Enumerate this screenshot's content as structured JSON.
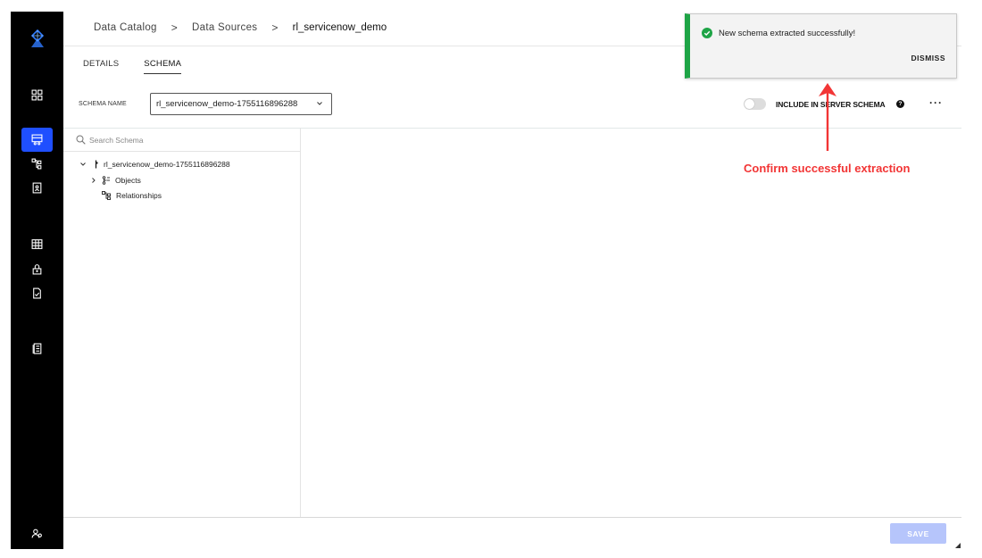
{
  "breadcrumb": {
    "item1": "Data Catalog",
    "item2": "Data Sources",
    "current": "rl_servicenow_demo",
    "separator": ">"
  },
  "tabs": {
    "details": "DETAILS",
    "schema": "SCHEMA"
  },
  "schema": {
    "name_label": "SCHEMA NAME",
    "selected": "rl_servicenow_demo-1755116896288",
    "include_label": "INCLUDE IN SERVER SCHEMA",
    "help": "?",
    "more": "···"
  },
  "search": {
    "placeholder": "Search Schema"
  },
  "tree": {
    "root": "rl_servicenow_demo-1755116896288",
    "objects": "Objects",
    "relationships": "Relationships"
  },
  "footer": {
    "save_label": "SAVE"
  },
  "toast": {
    "message": "New schema extracted successfully!",
    "dismiss_label": "DISMISS",
    "accent": "#1ea446"
  },
  "annotation": {
    "text": "Confirm successful extraction",
    "color": "#f23535"
  },
  "colors": {
    "nav_bg": "#000000",
    "nav_active": "#1f4fff",
    "save_disabled": "#b6c5fb"
  },
  "nav": {
    "items": [
      "grid-icon",
      "catalog-icon",
      "hierarchy-icon",
      "report-icon",
      "table-icon",
      "lock-icon",
      "checklist-icon",
      "docs-icon",
      "user-group-icon"
    ]
  }
}
